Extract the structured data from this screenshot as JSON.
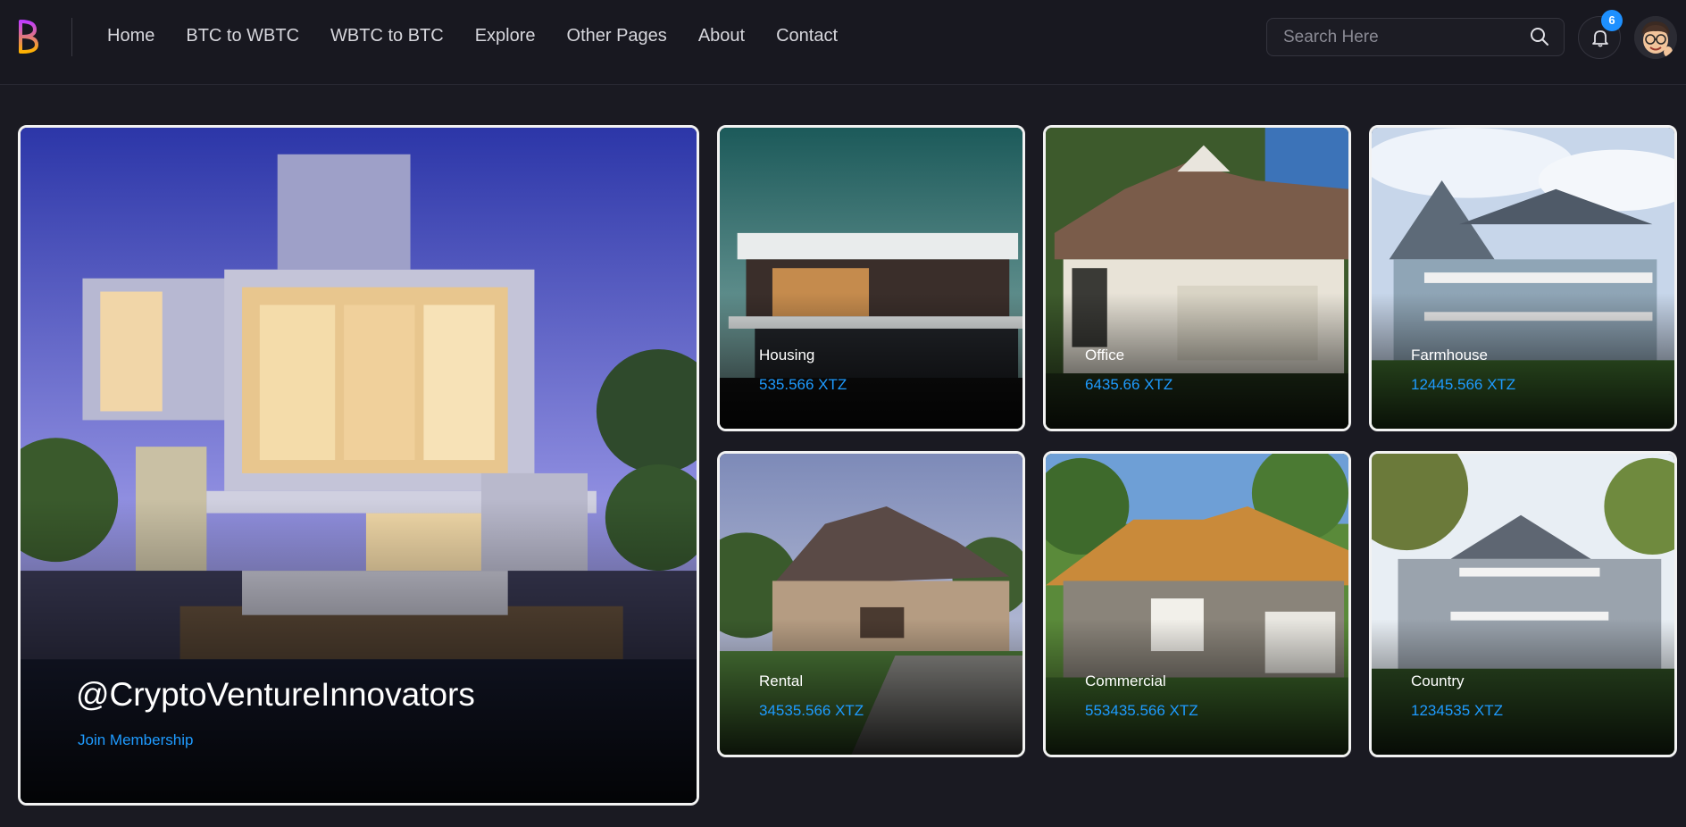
{
  "nav": {
    "items": [
      {
        "label": "Home"
      },
      {
        "label": "BTC to WBTC"
      },
      {
        "label": "WBTC to BTC"
      },
      {
        "label": "Explore"
      },
      {
        "label": "Other Pages"
      },
      {
        "label": "About"
      },
      {
        "label": "Contact"
      }
    ]
  },
  "search": {
    "placeholder": "Search Here"
  },
  "notifications": {
    "count": "6"
  },
  "hero": {
    "title": "@CryptoVentureInnovators",
    "link": "Join Membership"
  },
  "cards": [
    {
      "title": "Housing",
      "price": "535.566 XTZ"
    },
    {
      "title": "Office",
      "price": "6435.66 XTZ"
    },
    {
      "title": "Farmhouse",
      "price": "12445.566 XTZ"
    },
    {
      "title": "Rental",
      "price": "34535.566 XTZ"
    },
    {
      "title": "Commercial",
      "price": "553435.566 XTZ"
    },
    {
      "title": "Country",
      "price": "1234535 XTZ"
    }
  ],
  "colors": {
    "accent": "#1e9bff",
    "background": "#1a1a22"
  }
}
